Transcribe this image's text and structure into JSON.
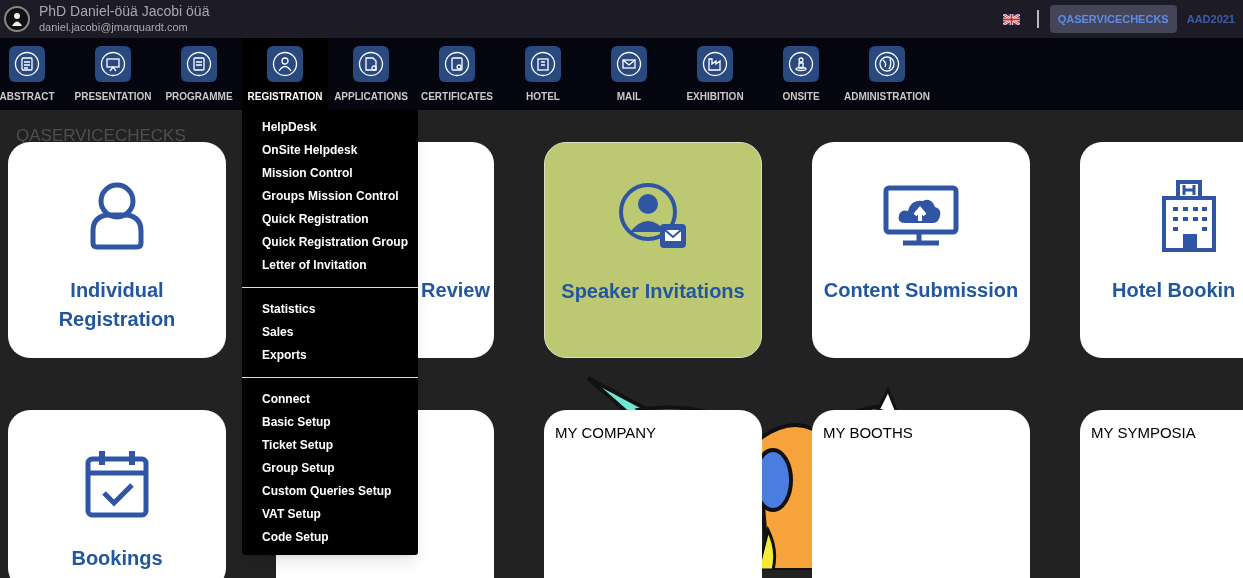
{
  "user": {
    "name": "PhD Daniel-öüä Jacobi öüä",
    "email": "daniel.jacobi@jmarquardt.com"
  },
  "header_actions": {
    "account_button": "QASERVICECHECKS",
    "event_code": "AAD2021"
  },
  "nav": [
    {
      "label": "ABSTRACT",
      "selected": false
    },
    {
      "label": "PRESENTATION",
      "selected": false
    },
    {
      "label": "PROGRAMME",
      "selected": false
    },
    {
      "label": "REGISTRATION",
      "selected": true
    },
    {
      "label": "APPLICATIONS",
      "selected": false
    },
    {
      "label": "CERTIFICATES",
      "selected": false
    },
    {
      "label": "HOTEL",
      "selected": false
    },
    {
      "label": "MAIL",
      "selected": false
    },
    {
      "label": "EXHIBITION",
      "selected": false
    },
    {
      "label": "ONSITE",
      "selected": false
    },
    {
      "label": "ADMINISTRATION",
      "selected": false
    }
  ],
  "dropdown": {
    "groups": [
      [
        "HelpDesk",
        "OnSite Helpdesk",
        "Mission Control",
        "Groups Mission Control",
        "Quick Registration",
        "Quick Registration Group",
        "Letter of Invitation"
      ],
      [
        "Statistics",
        "Sales",
        "Exports"
      ],
      [
        "Connect",
        "Basic Setup",
        "Ticket Setup",
        "Group Setup",
        "Custom Queries Setup",
        "VAT Setup",
        "Code Setup"
      ]
    ]
  },
  "page_title": "QASERVICECHECKS",
  "cards": [
    {
      "kind": "tile",
      "label": "Individual Registration",
      "selected": false
    },
    {
      "kind": "tile",
      "label": "Review",
      "selected": false
    },
    {
      "kind": "tile",
      "label": "Speaker Invitations",
      "selected": true
    },
    {
      "kind": "tile",
      "label": "Content Submission",
      "selected": false
    },
    {
      "kind": "tile",
      "label": "Hotel Bookin",
      "selected": false
    },
    {
      "kind": "tile",
      "label": "Bookings",
      "selected": false
    },
    {
      "kind": "blank"
    },
    {
      "kind": "panel",
      "label": "MY COMPANY"
    },
    {
      "kind": "panel",
      "label": "MY BOOTHS"
    },
    {
      "kind": "panel",
      "label": "MY SYMPOSIA"
    }
  ]
}
